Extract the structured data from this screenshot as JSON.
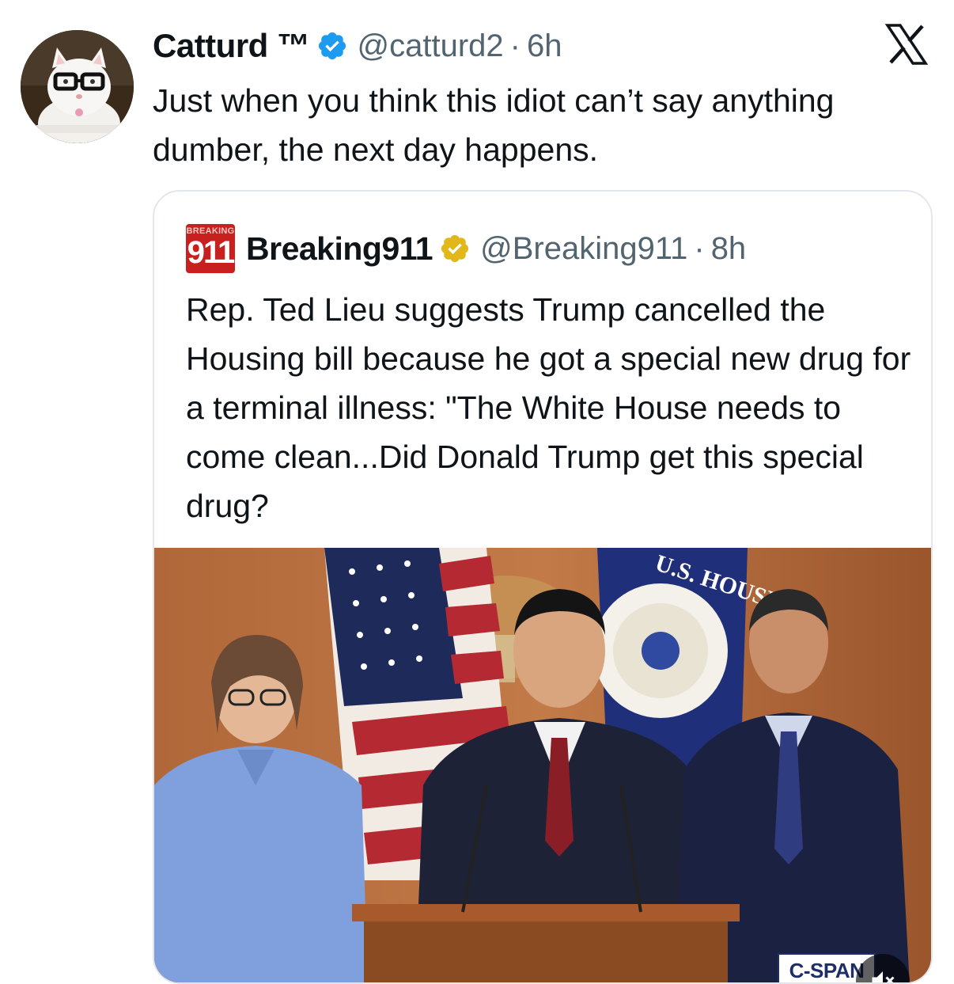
{
  "tweet": {
    "display_name": "Catturd ™",
    "handle": "@catturd2",
    "separator": "·",
    "time": "6h",
    "text": "Just when you think this idiot can’t say anything dumber, the next day happens.",
    "avatar_icon": "cat-with-glasses-avatar"
  },
  "quoted_tweet": {
    "avatar_label_small": "BREAKING",
    "avatar_label_big": "911",
    "display_name": "Breaking911",
    "handle": "@Breaking911",
    "separator": "·",
    "time": "8h",
    "text": "Rep. Ted Lieu suggests Trump cancelled the Housing bill because he got a special new drug for a terminal illness: \"The White House needs to come clean...Did Donald Trump get this special drug?",
    "media": {
      "watermark": "C-SPAN",
      "muted": true,
      "seal_text": "U.S. HOUSE"
    }
  },
  "colors": {
    "verified_blue": "#1d9bf0",
    "verified_gold": "#e2b719",
    "secondary_text": "#536471",
    "primary_text": "#0f1419",
    "breaking_red": "#c8201e"
  }
}
